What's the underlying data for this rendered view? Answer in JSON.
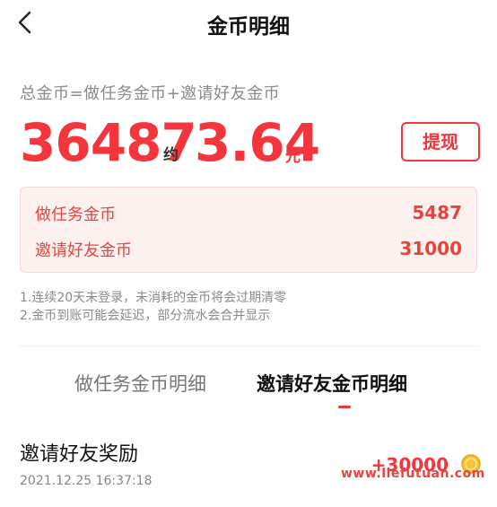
{
  "header": {
    "title": "金币明细",
    "back_icon": "chevron-left-icon"
  },
  "summary": {
    "formula": "总金币=做任务金币+邀请好友金币",
    "total_coins": "36487",
    "approx_label": "约",
    "cash_value": "3.64",
    "cash_unit": "元",
    "withdraw_label": "提现"
  },
  "breakdown": [
    {
      "label": "做任务金币",
      "value": "5487"
    },
    {
      "label": "邀请好友金币",
      "value": "31000"
    }
  ],
  "notes": [
    "1.连续20天未登录，未消耗的金币将会过期清零",
    "2.金币到账可能会延迟，部分流水会合并显示"
  ],
  "tabs": [
    {
      "label": "做任务金币明细",
      "active": false
    },
    {
      "label": "邀请好友金币明细",
      "active": true
    }
  ],
  "records": [
    {
      "title": "邀请好友奖励",
      "time": "2021.12.25 16:37:18",
      "amount": "+30000",
      "icon": "coin-icon"
    }
  ],
  "watermark": "www.liefutuan.com",
  "colors": {
    "accent": "#f4353c",
    "breakdown_bg": "#fdf1ef",
    "muted": "#8a8a8a"
  }
}
